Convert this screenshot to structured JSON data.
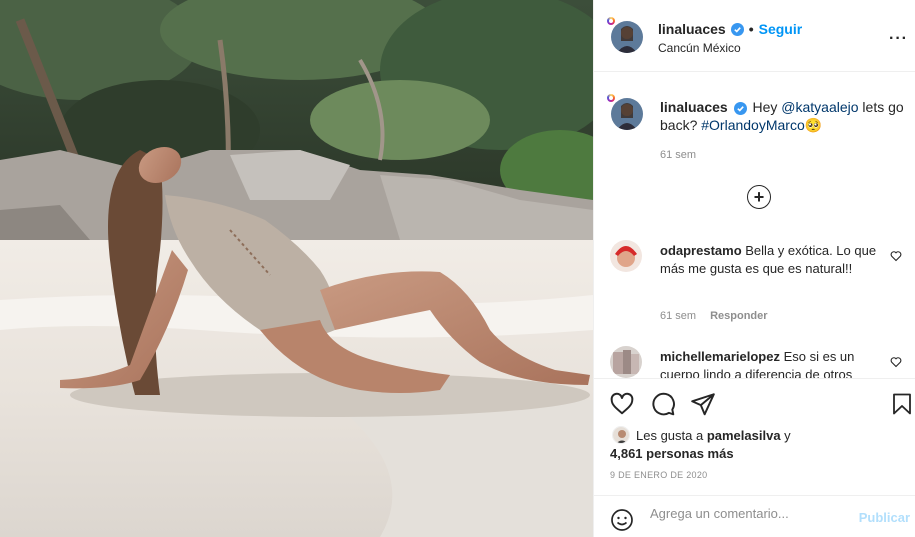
{
  "post": {
    "username": "linaluaces",
    "separator": "•",
    "follow_label": "Seguir",
    "location": "Cancún México",
    "more_label": "···"
  },
  "caption": {
    "username": "linaluaces",
    "text_pre": "Hey ",
    "mention": "@katyaalejo",
    "text_mid": " lets go back? ",
    "hashtag": "#OrlandoyMarco",
    "emoji": "🥺",
    "time": "61 sem"
  },
  "load_more_label": "+",
  "comments": [
    {
      "username": "odaprestamo",
      "text": "Bella y exótica. Lo que más me gusta es que es natural!!",
      "time": "61 sem",
      "reply_label": "Responder"
    },
    {
      "username": "michellemarielopez",
      "text": "Eso si es un cuerpo lindo a diferencia de otros",
      "time": "",
      "reply_label": ""
    }
  ],
  "likes": {
    "prefix": "Les gusta a ",
    "liker": "pamelasilva",
    "suffix": " y",
    "count": "4,861 personas más"
  },
  "date": "9 DE ENERO DE 2020",
  "add_comment": {
    "placeholder": "Agrega un comentario...",
    "publish_label": "Publicar"
  },
  "icons": {
    "options": "more-horizontal-icon",
    "verified": "verified-badge-icon",
    "like": "heart-icon",
    "comment": "comment-icon",
    "share": "paper-plane-icon",
    "save": "bookmark-icon",
    "emoji": "smiley-icon"
  },
  "colors": {
    "link_blue": "#0095f6",
    "mention_blue": "#00376b",
    "verified_blue": "#3897f0",
    "muted_gray": "#8e8e8e",
    "publish_disabled": "#b2dffc"
  }
}
